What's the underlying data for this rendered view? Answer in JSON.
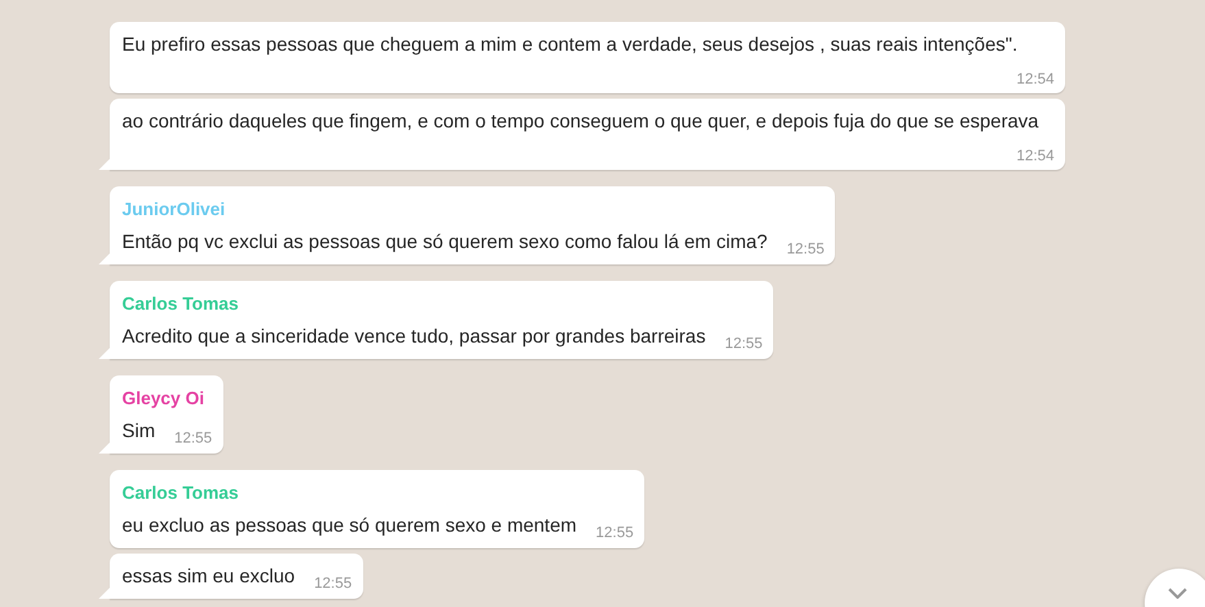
{
  "messages": [
    {
      "text": "Eu prefiro essas pessoas que cheguem a mim e contem a verdade, seus desejos , suas reais intenções\".",
      "time": "12:54",
      "tail": false
    },
    {
      "text": "ao contrário daqueles que fingem, e com o tempo conseguem o que quer, e depois fuja do que se esperava",
      "time": "12:54",
      "tail": true
    },
    {
      "sender": "JuniorOlivei",
      "color": "#6bcbef",
      "text": "Então pq vc exclui as pessoas que só querem sexo como falou lá em cima?",
      "time": "12:55",
      "tail": true
    },
    {
      "sender": "Carlos Tomas",
      "color": "#35cd96",
      "text": "Acredito que a sinceridade vence tudo, passar por grandes barreiras",
      "time": "12:55",
      "tail": true
    },
    {
      "sender": "Gleycy Oi",
      "color": "#e542a3",
      "text": "Sim",
      "time": "12:55",
      "tail": true
    },
    {
      "sender": "Carlos Tomas",
      "color": "#35cd96",
      "text": "eu excluo as pessoas que só querem sexo e mentem",
      "time": "12:55",
      "tail": false
    },
    {
      "text": "essas sim eu excluo",
      "time": "12:55",
      "tail": true
    }
  ]
}
